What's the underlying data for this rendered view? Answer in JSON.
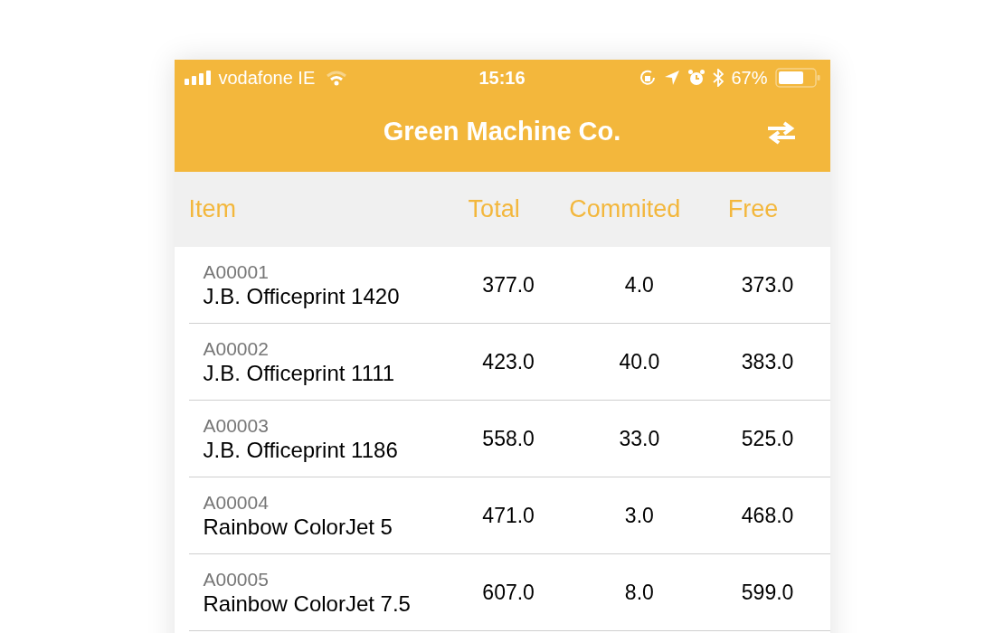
{
  "status_bar": {
    "carrier": "vodafone IE",
    "time": "15:16",
    "battery": "67%"
  },
  "nav_bar": {
    "title": "Green Machine Co."
  },
  "table": {
    "columns": [
      "Item",
      "Total",
      "Commited",
      "Free"
    ],
    "rows": [
      {
        "code": "A00001",
        "name": "J.B. Officeprint 1420",
        "total": "377.0",
        "commited": "4.0",
        "free": "373.0"
      },
      {
        "code": "A00002",
        "name": "J.B. Officeprint 1111",
        "total": "423.0",
        "commited": "40.0",
        "free": "383.0"
      },
      {
        "code": "A00003",
        "name": "J.B. Officeprint 1186",
        "total": "558.0",
        "commited": "33.0",
        "free": "525.0"
      },
      {
        "code": "A00004",
        "name": "Rainbow ColorJet 5",
        "total": "471.0",
        "commited": "3.0",
        "free": "468.0"
      },
      {
        "code": "A00005",
        "name": "Rainbow ColorJet 7.5",
        "total": "607.0",
        "commited": "8.0",
        "free": "599.0"
      }
    ]
  }
}
